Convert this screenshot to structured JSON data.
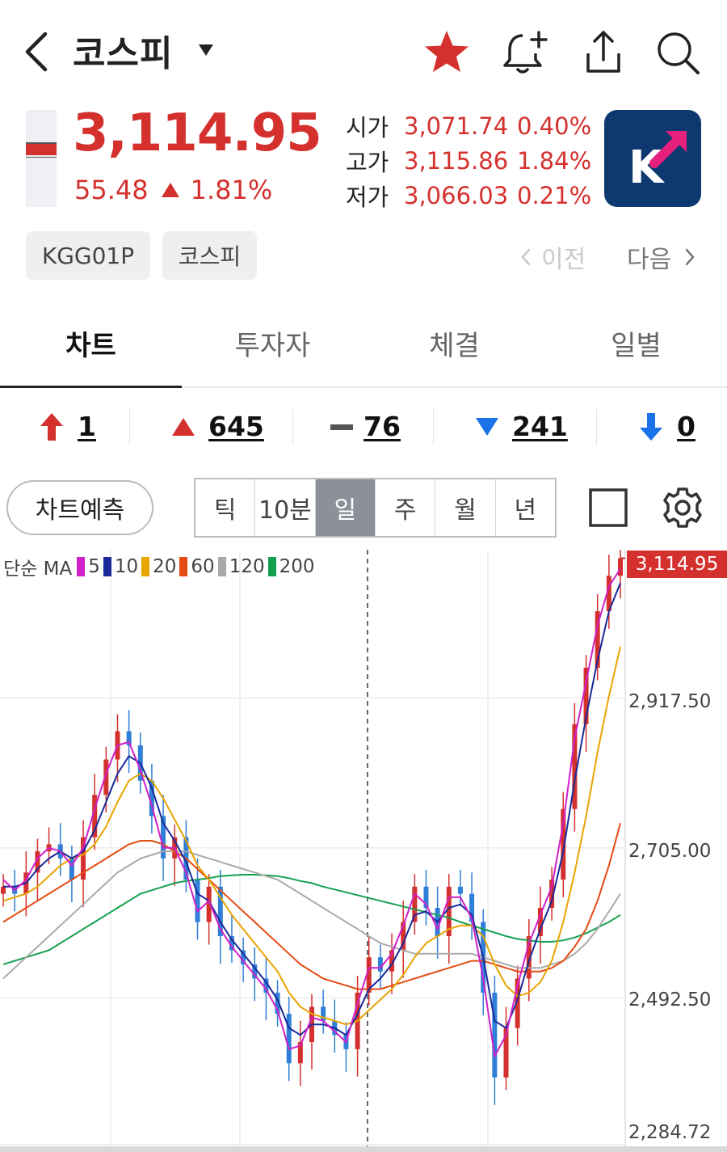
{
  "header": {
    "title": "코스피",
    "icons": [
      "back-icon",
      "star-icon",
      "bell-add-icon",
      "share-icon",
      "search-icon"
    ],
    "favorite_color": "#d4312e"
  },
  "price": {
    "current": "3,114.95",
    "change": "55.48",
    "change_pct": "1.81%",
    "direction": "up",
    "color": "#d4312e"
  },
  "ohl": [
    {
      "label": "시가",
      "value": "3,071.74",
      "pct": "0.40%"
    },
    {
      "label": "고가",
      "value": "3,115.86",
      "pct": "1.84%"
    },
    {
      "label": "저가",
      "value": "3,066.03",
      "pct": "0.21%"
    }
  ],
  "logo": {
    "letter": "K",
    "bg": "#0d3870",
    "accent": "#e6207c"
  },
  "chips": [
    "KGG01P",
    "코스피"
  ],
  "nav": {
    "prev": "이전",
    "next": "다음"
  },
  "tabs": [
    {
      "label": "차트",
      "active": true
    },
    {
      "label": "투자자",
      "active": false
    },
    {
      "label": "체결",
      "active": false
    },
    {
      "label": "일별",
      "active": false
    }
  ],
  "stats": {
    "limit_up": "1",
    "up": "645",
    "unchanged": "76",
    "down": "241",
    "limit_down": "0"
  },
  "controls": {
    "predict": "차트예측",
    "periods": [
      "틱",
      "10분",
      "일",
      "주",
      "월",
      "년"
    ],
    "active_period": "일"
  },
  "chart_data": {
    "type": "line",
    "legend_prefix": "단순 MA",
    "ma_series": [
      {
        "name": "5",
        "color": "#d020c8"
      },
      {
        "name": "10",
        "color": "#1a2a9a"
      },
      {
        "name": "20",
        "color": "#e8a400"
      },
      {
        "name": "60",
        "color": "#e54b13"
      },
      {
        "name": "120",
        "color": "#aaaaaa"
      },
      {
        "name": "200",
        "color": "#15a050"
      }
    ],
    "y_ticks": [
      "2,917.50",
      "2,705.00",
      "2,492.50",
      "2,284.72"
    ],
    "last_price": "3,114.95",
    "ylim": [
      2284.72,
      3127
    ],
    "close": [
      2650,
      2640,
      2670,
      2700,
      2710,
      2690,
      2660,
      2720,
      2780,
      2830,
      2870,
      2850,
      2800,
      2750,
      2690,
      2720,
      2660,
      2600,
      2650,
      2580,
      2560,
      2540,
      2520,
      2500,
      2470,
      2400,
      2430,
      2480,
      2460,
      2440,
      2420,
      2500,
      2550,
      2530,
      2560,
      2600,
      2650,
      2620,
      2580,
      2650,
      2640,
      2600,
      2500,
      2380,
      2450,
      2520,
      2580,
      2620,
      2660,
      2760,
      2880,
      2960,
      3040,
      3090,
      3114.95
    ],
    "ma5": [
      2660,
      2645,
      2660,
      2690,
      2705,
      2700,
      2680,
      2705,
      2760,
      2810,
      2850,
      2855,
      2815,
      2765,
      2705,
      2705,
      2670,
      2615,
      2630,
      2590,
      2565,
      2545,
      2525,
      2505,
      2475,
      2420,
      2425,
      2465,
      2460,
      2445,
      2430,
      2485,
      2535,
      2535,
      2555,
      2595,
      2640,
      2625,
      2590,
      2635,
      2635,
      2605,
      2520,
      2410,
      2440,
      2510,
      2570,
      2610,
      2650,
      2740,
      2860,
      2940,
      3020,
      3075,
      3100
    ],
    "ma10": [
      2650,
      2650,
      2655,
      2675,
      2690,
      2700,
      2690,
      2700,
      2730,
      2770,
      2810,
      2835,
      2825,
      2790,
      2740,
      2715,
      2685,
      2640,
      2630,
      2600,
      2575,
      2555,
      2535,
      2515,
      2490,
      2450,
      2440,
      2455,
      2455,
      2450,
      2440,
      2470,
      2505,
      2520,
      2540,
      2570,
      2610,
      2615,
      2600,
      2620,
      2625,
      2610,
      2550,
      2460,
      2450,
      2490,
      2545,
      2590,
      2630,
      2700,
      2800,
      2890,
      2970,
      3040,
      3080
    ],
    "ma20": [
      2630,
      2635,
      2640,
      2650,
      2665,
      2680,
      2690,
      2695,
      2710,
      2735,
      2770,
      2800,
      2810,
      2800,
      2775,
      2745,
      2715,
      2680,
      2660,
      2635,
      2610,
      2590,
      2570,
      2550,
      2530,
      2500,
      2480,
      2470,
      2465,
      2460,
      2455,
      2460,
      2475,
      2490,
      2505,
      2525,
      2550,
      2570,
      2580,
      2590,
      2595,
      2595,
      2580,
      2540,
      2510,
      2495,
      2500,
      2515,
      2545,
      2600,
      2670,
      2750,
      2840,
      2920,
      2990
    ],
    "ma60": [
      2600,
      2610,
      2620,
      2630,
      2640,
      2650,
      2660,
      2670,
      2680,
      2690,
      2700,
      2710,
      2715,
      2715,
      2710,
      2700,
      2690,
      2675,
      2660,
      2645,
      2630,
      2615,
      2600,
      2585,
      2570,
      2555,
      2540,
      2530,
      2520,
      2515,
      2510,
      2505,
      2505,
      2505,
      2510,
      2515,
      2520,
      2525,
      2530,
      2535,
      2540,
      2545,
      2545,
      2540,
      2535,
      2530,
      2530,
      2530,
      2535,
      2545,
      2565,
      2590,
      2630,
      2680,
      2740
    ],
    "ma120": [
      2520,
      2535,
      2550,
      2565,
      2580,
      2595,
      2610,
      2625,
      2640,
      2655,
      2670,
      2680,
      2690,
      2695,
      2700,
      2700,
      2700,
      2695,
      2690,
      2685,
      2680,
      2675,
      2670,
      2665,
      2660,
      2650,
      2640,
      2630,
      2620,
      2610,
      2600,
      2590,
      2580,
      2570,
      2565,
      2560,
      2555,
      2555,
      2555,
      2555,
      2555,
      2555,
      2550,
      2545,
      2540,
      2535,
      2535,
      2535,
      2540,
      2545,
      2555,
      2570,
      2590,
      2615,
      2640
    ],
    "ma200": [
      2540,
      2545,
      2550,
      2555,
      2560,
      2570,
      2580,
      2590,
      2600,
      2610,
      2620,
      2630,
      2640,
      2645,
      2650,
      2655,
      2658,
      2660,
      2662,
      2665,
      2666,
      2667,
      2667,
      2666,
      2665,
      2662,
      2658,
      2655,
      2650,
      2646,
      2642,
      2638,
      2634,
      2630,
      2626,
      2622,
      2618,
      2614,
      2610,
      2606,
      2600,
      2595,
      2590,
      2585,
      2580,
      2576,
      2574,
      2572,
      2572,
      2574,
      2578,
      2584,
      2592,
      2600,
      2610
    ]
  }
}
